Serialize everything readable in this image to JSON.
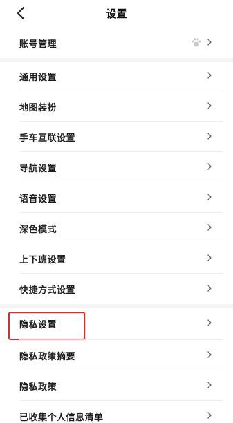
{
  "header": {
    "title": "设置",
    "back_icon": "chevron-left-icon"
  },
  "items": [
    {
      "label": "账号管理",
      "has_avatar": true,
      "avatar_icon": "paw-icon"
    },
    {
      "label": "通用设置"
    },
    {
      "label": "地图装扮"
    },
    {
      "label": "手车互联设置"
    },
    {
      "label": "导航设置"
    },
    {
      "label": "语音设置"
    },
    {
      "label": "深色模式"
    },
    {
      "label": "上下班设置"
    },
    {
      "label": "快捷方式设置"
    },
    {
      "label": "隐私设置",
      "highlighted": true
    },
    {
      "label": "隐私政策摘要"
    },
    {
      "label": "隐私政策"
    },
    {
      "label": "已收集个人信息清单"
    }
  ],
  "colors": {
    "highlight": "#e02a2a",
    "chevron": "#666666",
    "text": "#1e1e1e"
  }
}
